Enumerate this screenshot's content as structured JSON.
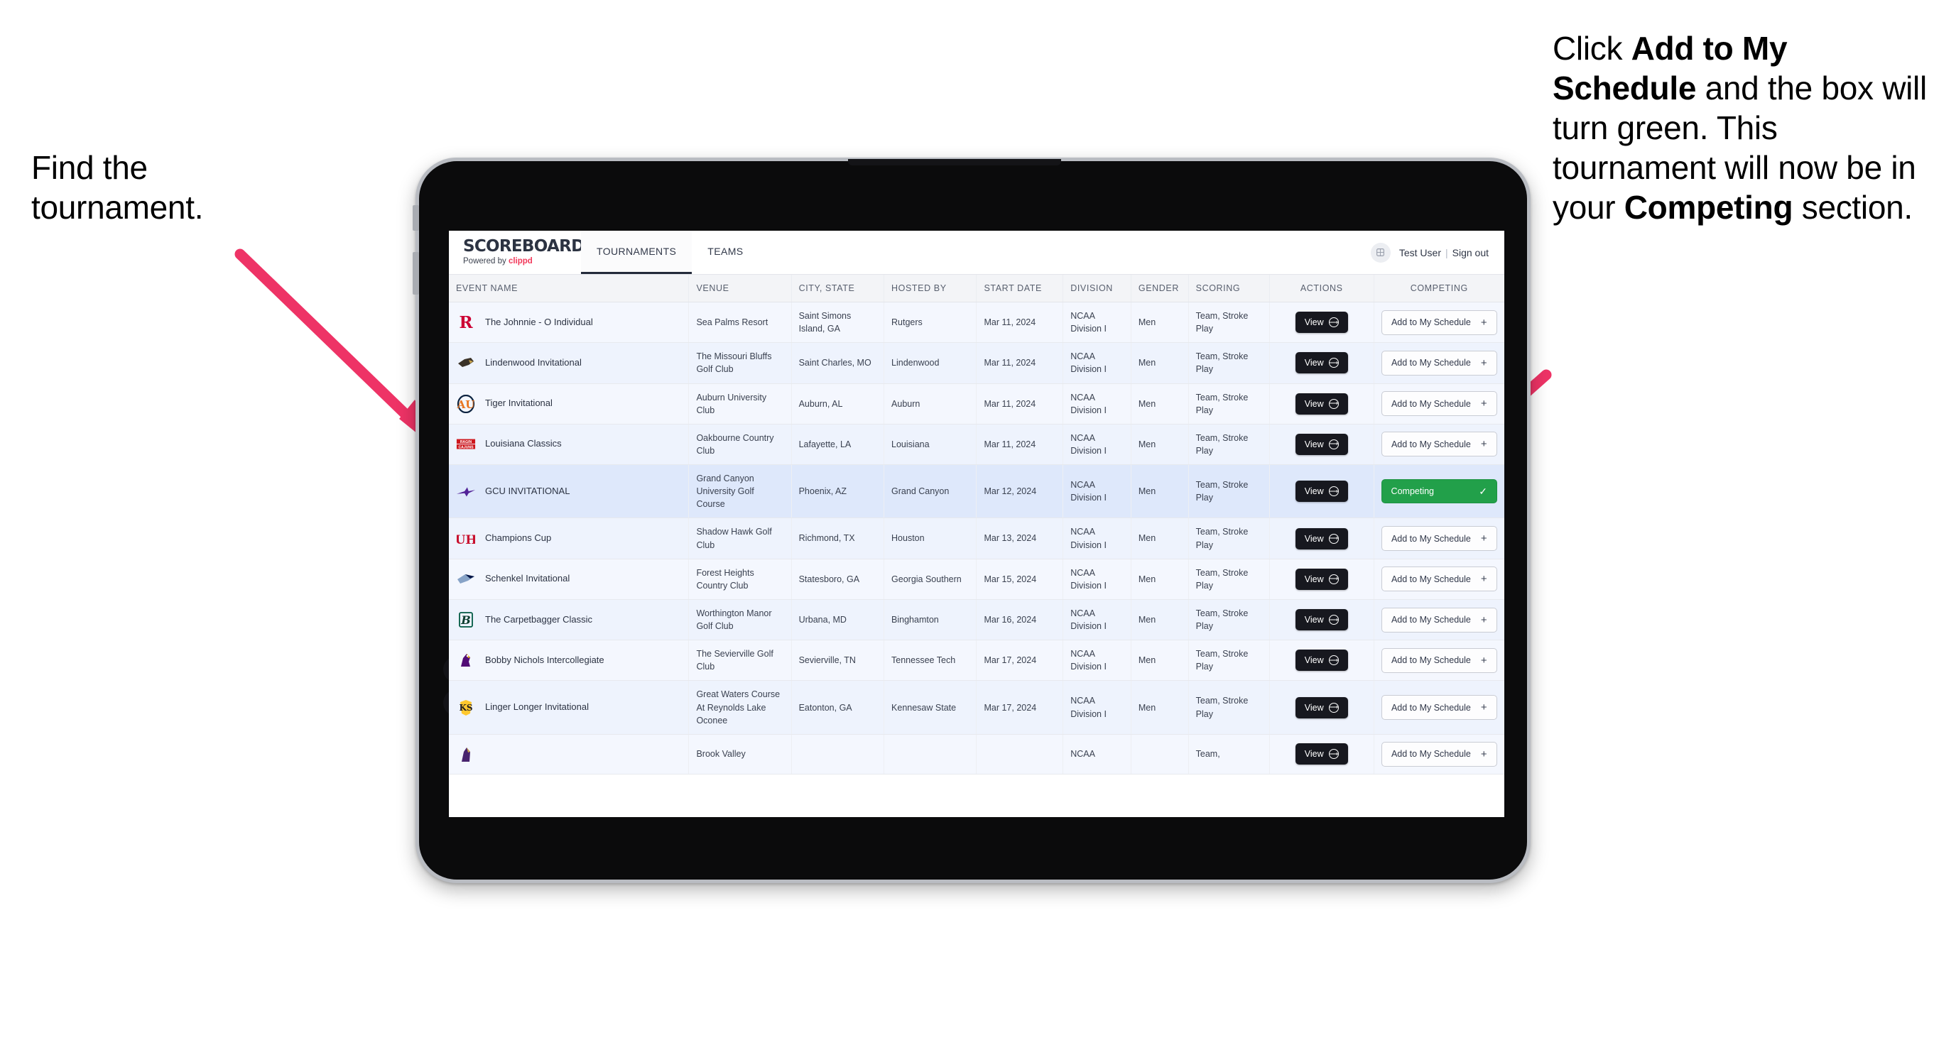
{
  "annotations": {
    "left": {
      "line1": "Find the",
      "line2": "tournament."
    },
    "right": {
      "seg1": "Click ",
      "bold1": "Add to My Schedule",
      "seg2": " and the box will turn green. This tournament will now be in your ",
      "bold2": "Competing",
      "seg3": " section."
    }
  },
  "colors": {
    "arrow": "#ee3366",
    "brand_accent": "#f2385a",
    "competing_green": "#22a04a",
    "view_button": "#17181f",
    "selected_row": "#dee8fb"
  },
  "app": {
    "brand": {
      "title": "SCOREBOARD",
      "powered_prefix": "Powered by ",
      "powered_brand": "clippd"
    },
    "nav": [
      {
        "label": "TOURNAMENTS",
        "active": true
      },
      {
        "label": "TEAMS",
        "active": false
      }
    ],
    "user": {
      "avatar_icon": "user-grid-icon",
      "name": "Test User",
      "separator": "|",
      "sign_out": "Sign out"
    }
  },
  "table": {
    "columns": [
      "EVENT NAME",
      "VENUE",
      "CITY, STATE",
      "HOSTED BY",
      "START DATE",
      "DIVISION",
      "GENDER",
      "SCORING",
      "ACTIONS",
      "COMPETING"
    ],
    "buttons": {
      "view": "View",
      "view_icon": "arrow-right-circle-icon",
      "add": "Add to My Schedule",
      "add_icon": "plus-icon",
      "competing": "Competing",
      "competing_icon": "check-icon"
    },
    "rows": [
      {
        "logo": "rutgers-r-logo",
        "event": "The Johnnie - O Individual",
        "venue": "Sea Palms Resort",
        "city": "Saint Simons Island, GA",
        "host": "Rutgers",
        "date": "Mar 11, 2024",
        "division": "NCAA Division I",
        "gender": "Men",
        "scoring": "Team, Stroke Play",
        "competing": false
      },
      {
        "logo": "lindenwood-lion-logo",
        "event": "Lindenwood Invitational",
        "venue": "The Missouri Bluffs Golf Club",
        "city": "Saint Charles, MO",
        "host": "Lindenwood",
        "date": "Mar 11, 2024",
        "division": "NCAA Division I",
        "gender": "Men",
        "scoring": "Team, Stroke Play",
        "competing": false
      },
      {
        "logo": "auburn-au-logo",
        "event": "Tiger Invitational",
        "venue": "Auburn University Club",
        "city": "Auburn, AL",
        "host": "Auburn",
        "date": "Mar 11, 2024",
        "division": "NCAA Division I",
        "gender": "Men",
        "scoring": "Team, Stroke Play",
        "competing": false
      },
      {
        "logo": "louisiana-ragin-cajuns-logo",
        "event": "Louisiana Classics",
        "venue": "Oakbourne Country Club",
        "city": "Lafayette, LA",
        "host": "Louisiana",
        "date": "Mar 11, 2024",
        "division": "NCAA Division I",
        "gender": "Men",
        "scoring": "Team, Stroke Play",
        "competing": false
      },
      {
        "logo": "grand-canyon-lopes-logo",
        "event": "GCU INVITATIONAL",
        "venue": "Grand Canyon University Golf Course",
        "city": "Phoenix, AZ",
        "host": "Grand Canyon",
        "date": "Mar 12, 2024",
        "division": "NCAA Division I",
        "gender": "Men",
        "scoring": "Team, Stroke Play",
        "competing": true,
        "selected": true
      },
      {
        "logo": "houston-uh-logo",
        "event": "Champions Cup",
        "venue": "Shadow Hawk Golf Club",
        "city": "Richmond, TX",
        "host": "Houston",
        "date": "Mar 13, 2024",
        "division": "NCAA Division I",
        "gender": "Men",
        "scoring": "Team, Stroke Play",
        "competing": false
      },
      {
        "logo": "georgia-southern-eagles-logo",
        "event": "Schenkel Invitational",
        "venue": "Forest Heights Country Club",
        "city": "Statesboro, GA",
        "host": "Georgia Southern",
        "date": "Mar 15, 2024",
        "division": "NCAA Division I",
        "gender": "Men",
        "scoring": "Team, Stroke Play",
        "competing": false
      },
      {
        "logo": "binghamton-b-logo",
        "event": "The Carpetbagger Classic",
        "venue": "Worthington Manor Golf Club",
        "city": "Urbana, MD",
        "host": "Binghamton",
        "date": "Mar 16, 2024",
        "division": "NCAA Division I",
        "gender": "Men",
        "scoring": "Team, Stroke Play",
        "competing": false
      },
      {
        "logo": "tennessee-tech-eagle-logo",
        "event": "Bobby Nichols Intercollegiate",
        "venue": "The Sevierville Golf Club",
        "city": "Sevierville, TN",
        "host": "Tennessee Tech",
        "date": "Mar 17, 2024",
        "division": "NCAA Division I",
        "gender": "Men",
        "scoring": "Team, Stroke Play",
        "competing": false
      },
      {
        "logo": "kennesaw-state-owls-logo",
        "event": "Linger Longer Invitational",
        "venue": "Great Waters Course At Reynolds Lake Oconee",
        "city": "Eatonton, GA",
        "host": "Kennesaw State",
        "date": "Mar 17, 2024",
        "division": "NCAA Division I",
        "gender": "Men",
        "scoring": "Team, Stroke Play",
        "competing": false
      },
      {
        "logo": "partial-row-logo",
        "event": "",
        "venue": "Brook Valley",
        "city": "",
        "host": "",
        "date": "",
        "division": "NCAA",
        "gender": "",
        "scoring": "Team,",
        "competing": false,
        "partial": true
      }
    ]
  }
}
